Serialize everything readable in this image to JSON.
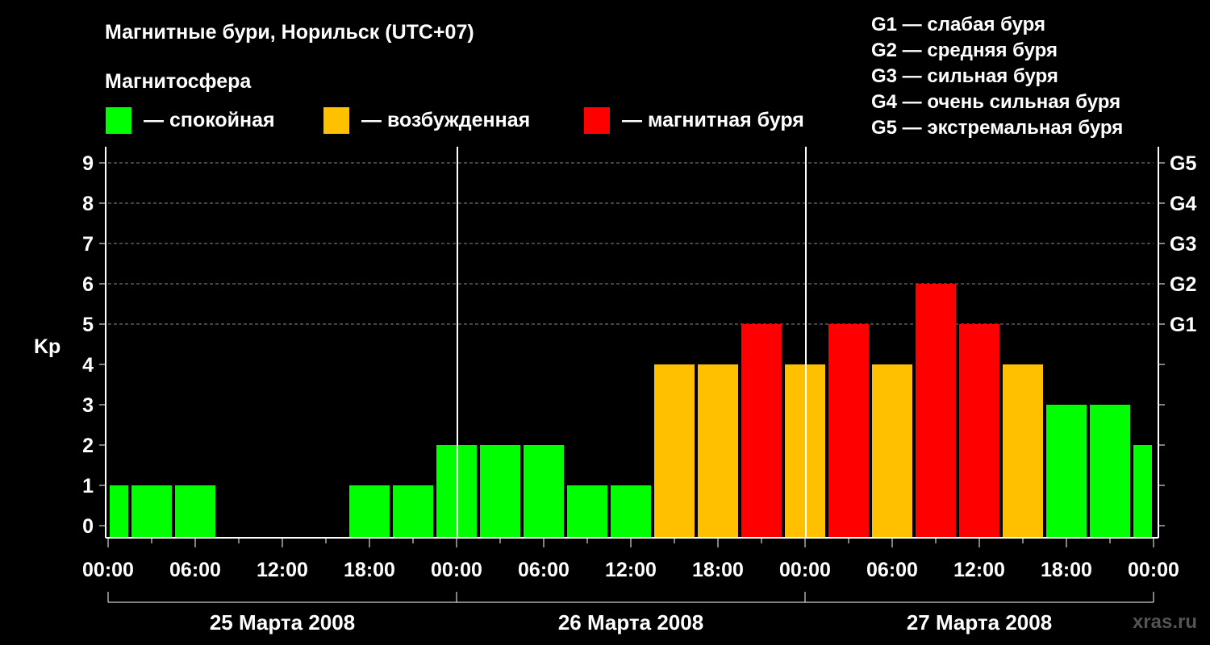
{
  "chart_data": {
    "type": "bar",
    "title": "Магнитные бури, Норильск (UTC+07)",
    "legend_heading": "Магнитосфера",
    "legend": [
      {
        "label": "— спокойная",
        "color": "#00ff00"
      },
      {
        "label": "— возбужденная",
        "color": "#ffc000"
      },
      {
        "label": "— магнитная буря",
        "color": "#ff0000"
      }
    ],
    "storm_scale": [
      "G1 — слабая буря",
      "G2 — средняя буря",
      "G3 — сильная буря",
      "G4 — очень сильная буря",
      "G5 — экстремальная буря"
    ],
    "ylabel": "Kp",
    "ylim": [
      0,
      9
    ],
    "yticks": [
      "0",
      "1",
      "2",
      "3",
      "4",
      "5",
      "6",
      "7",
      "8",
      "9"
    ],
    "right_labels": [
      {
        "value": 5,
        "label": "G1"
      },
      {
        "value": 6,
        "label": "G2"
      },
      {
        "value": 7,
        "label": "G3"
      },
      {
        "value": 8,
        "label": "G4"
      },
      {
        "value": 9,
        "label": "G5"
      }
    ],
    "xticks": [
      "00:00",
      "06:00",
      "12:00",
      "18:00",
      "00:00",
      "06:00",
      "12:00",
      "18:00",
      "00:00",
      "06:00",
      "12:00",
      "18:00",
      "00:00"
    ],
    "days": [
      "25 Марта 2008",
      "26 Марта 2008",
      "27 Марта 2008"
    ],
    "series": [
      {
        "x_hours": [
          0,
          3,
          6,
          9,
          12,
          15,
          18,
          21,
          24,
          27,
          30,
          33,
          36,
          39,
          42,
          45,
          48,
          51,
          54,
          57,
          60,
          63,
          66,
          69,
          72
        ],
        "kp": [
          1,
          1,
          1,
          0,
          0,
          0,
          1,
          1,
          2,
          2,
          2,
          1,
          1,
          4,
          4,
          5,
          4,
          5,
          4,
          6,
          5,
          4,
          3,
          3,
          2
        ],
        "color_key": [
          "q",
          "q",
          "q",
          "q",
          "q",
          "q",
          "q",
          "q",
          "q",
          "q",
          "q",
          "q",
          "q",
          "a",
          "a",
          "s",
          "a",
          "s",
          "a",
          "s",
          "s",
          "a",
          "q",
          "q",
          "q"
        ]
      }
    ],
    "grid_dashed_from": 5,
    "watermark": "xras.ru"
  }
}
